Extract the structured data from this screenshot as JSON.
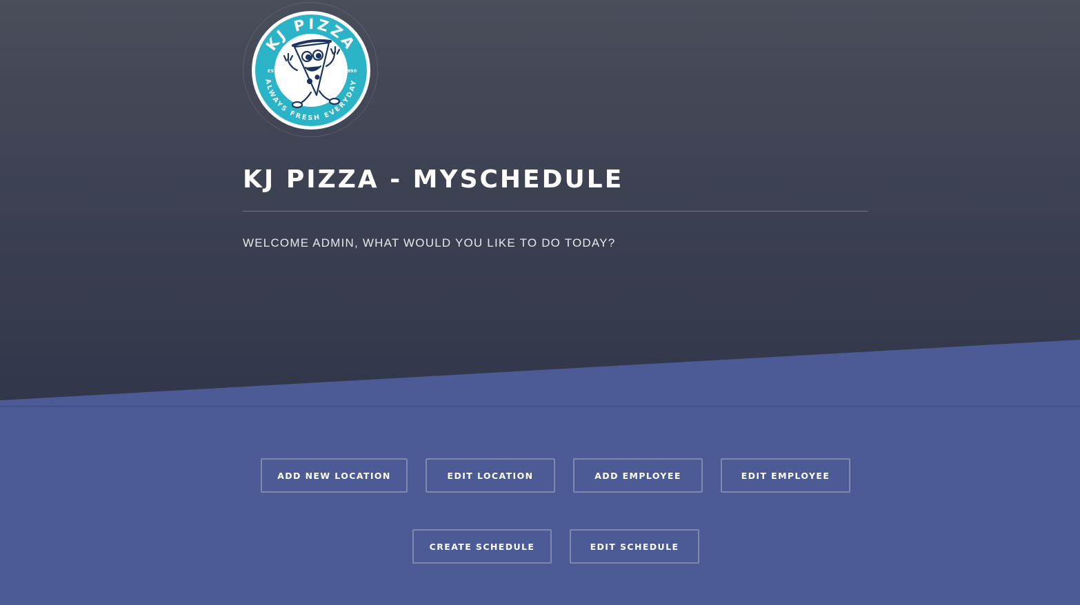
{
  "logo": {
    "brand_text": "KJ PIZZA",
    "estd": "ESTD",
    "year": "1990",
    "tagline": "ALWAYS FRESH EVERYDAY",
    "color_teal": "#2bb3c8",
    "color_navy": "#1b3560"
  },
  "header": {
    "title": "KJ PIZZA - MYSCHEDULE",
    "welcome": "WELCOME ADMIN, WHAT WOULD YOU LIKE TO DO TODAY?"
  },
  "actions": {
    "add_location": "ADD NEW LOCATION",
    "edit_location": "EDIT LOCATION",
    "add_employee": "ADD EMPLOYEE",
    "edit_employee": "EDIT EMPLOYEE",
    "create_schedule": "CREATE SCHEDULE",
    "edit_schedule": "EDIT SCHEDULE"
  },
  "colors": {
    "banner": "#3d4252",
    "body": "#4c5a96"
  }
}
